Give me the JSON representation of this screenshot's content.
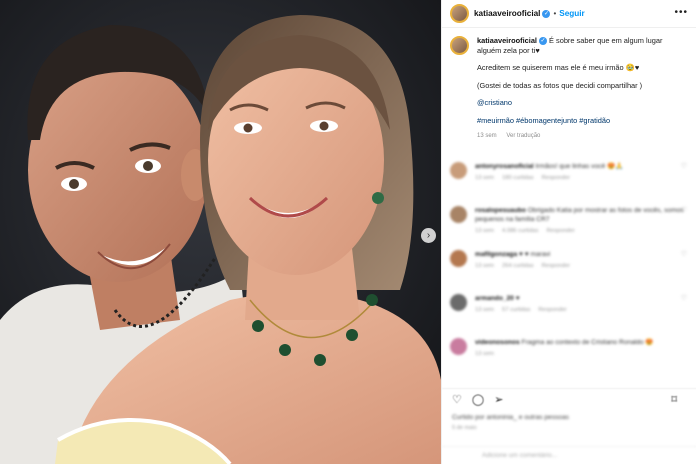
{
  "header": {
    "username": "katiaaveirooficial",
    "separator": "•",
    "follow_label": "Seguir",
    "more_label": "•••"
  },
  "caption": {
    "username": "katiaaveirooficial",
    "line1": " É sobre saber que em algum lugar alguém zela por ti♥",
    "line2": "Acreditem se quiserem mas ele é meu irmão 🥹♥",
    "line3": "(Gostei de todas as fotos que decidi compartilhar )",
    "mention": "@cristiano",
    "hashtags": "#meuirmão #ébomagentejunto #gratidão",
    "time": "13 sem",
    "translate": "Ver tradução"
  },
  "comments": [
    {
      "user": "antonyrosanoficial",
      "text": "Irmãos! que linhas você 😍🙏",
      "time": "13 sem",
      "likes": "180 curtidas",
      "reply": "Responder",
      "avatar_color": "#c99a74"
    },
    {
      "user": "rosalopesuaubo",
      "text": "Obrigado Katia por mostrar as fotos de vocês, somos pequenos na família CR7",
      "time": "13 sem",
      "likes": "4.086 curtidas",
      "reply": "Responder",
      "avatar_color": "#a88466"
    },
    {
      "user": "mafilgonzaga",
      "text": "♥ ♥ maravi",
      "time": "13 sem",
      "likes": "264 curtidas",
      "reply": "Responder",
      "avatar_color": "#b4784f"
    },
    {
      "user": "armando_20",
      "text": "♥",
      "time": "13 sem",
      "likes": "57 curtidas",
      "reply": "Responder",
      "avatar_color": "#6b6b6b"
    },
    {
      "user": "videonosonos",
      "text": "Fragma ao contexto de Cristiano Ronaldo 😍",
      "time": "13 sem",
      "likes": "",
      "reply": "",
      "avatar_color": "#c97c9f"
    }
  ],
  "actions": {
    "like_icon": "heart-icon",
    "comment_icon": "comment-icon",
    "share_icon": "share-icon",
    "save_icon": "bookmark-icon"
  },
  "likes_text": "Curtido por antoninia_ e outras pessoas",
  "date_text": "5 de maio",
  "add_comment_placeholder": "Adicione um comentário...",
  "colors": {
    "link": "#0095f6",
    "verified": "#3897f0",
    "hashtag": "#00376b"
  }
}
